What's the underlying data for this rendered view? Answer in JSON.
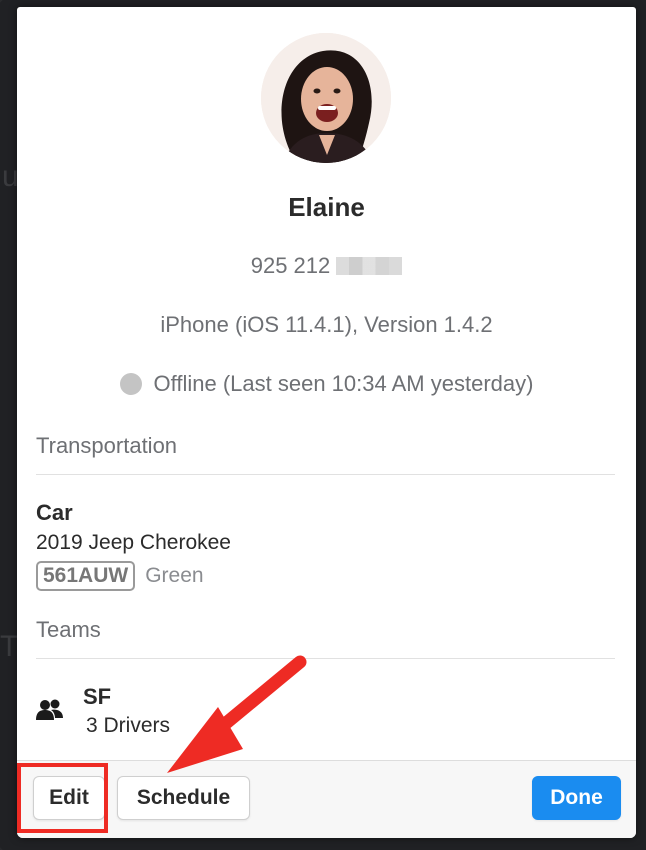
{
  "profile": {
    "name": "Elaine",
    "phone_visible": "925 212",
    "device": "iPhone (iOS 11.4.1), Version 1.4.2",
    "status": "Offline (Last seen 10:34 AM yesterday)"
  },
  "transportation": {
    "section_title": "Transportation",
    "type": "Car",
    "model": "2019 Jeep Cherokee",
    "plate": "561AUW",
    "color": "Green"
  },
  "teams": {
    "section_title": "Teams",
    "items": [
      {
        "name": "SF",
        "count": "3 Drivers"
      }
    ]
  },
  "footer": {
    "edit_label": "Edit",
    "schedule_label": "Schedule",
    "done_label": "Done"
  },
  "colors": {
    "primary": "#1a8cf0",
    "annotation": "#ee2b24",
    "status_offline": "#c4c4c4"
  },
  "icons": {
    "team": "people-icon",
    "status": "status-dot-icon"
  }
}
